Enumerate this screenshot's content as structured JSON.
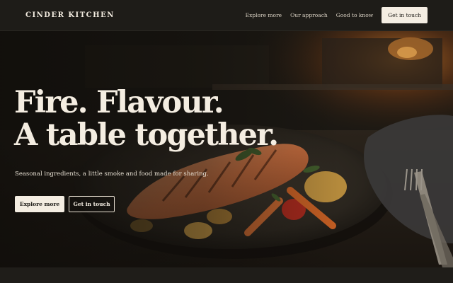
{
  "header": {
    "brand": "CINDER KITCHEN",
    "nav": [
      {
        "label": "Explore more"
      },
      {
        "label": "Our approach"
      },
      {
        "label": "Good to know"
      }
    ],
    "cta_label": "Get in touch"
  },
  "hero": {
    "headline_line1": "Fire. Flavour.",
    "headline_line2": "A table together.",
    "subtitle": "Seasonal ingredients, a little smoke and food made for sharing.",
    "primary_button": "Explore more",
    "secondary_button": "Get in touch"
  },
  "colors": {
    "background": "#1c1a16",
    "cream": "#f4ede2",
    "text_light": "#f3ece0"
  }
}
